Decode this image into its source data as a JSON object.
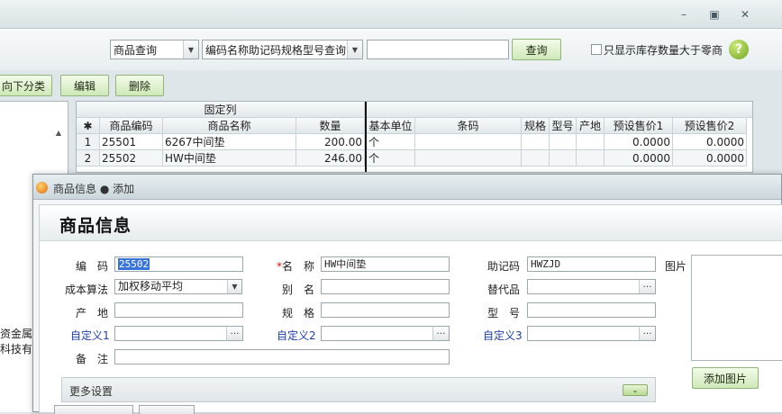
{
  "window": {
    "controls": [
      "minimize",
      "maximize",
      "close"
    ]
  },
  "toolbar": {
    "query_type": "商品查询",
    "query_field": "编码名称助记码规格型号查询",
    "search_value": "",
    "search_button": "查询",
    "stock_filter_label": "只显示库存数量大于零商",
    "help_label": "?",
    "move_down_button": "向下分类",
    "edit_button": "编辑",
    "delete_button": "删除"
  },
  "left_panel": {
    "lines": [
      "资金属",
      "科技有l"
    ]
  },
  "grid": {
    "frozen_label": "固定列",
    "columns": [
      "✱",
      "商品编码",
      "商品名称",
      "数量",
      "基本单位",
      "条码",
      "规格",
      "型号",
      "产地",
      "预设售价1",
      "预设售价2"
    ],
    "rows": [
      [
        "1",
        "25501",
        "6267中间垫",
        "200.00",
        "个",
        "",
        "",
        "",
        "",
        "0.0000",
        "0.0000"
      ],
      [
        "2",
        "25502",
        "HW中间垫",
        "246.00",
        "个",
        "",
        "",
        "",
        "",
        "0.0000",
        "0.0000"
      ]
    ]
  },
  "dialog": {
    "title": "商品信息 ● 添加",
    "heading": "商品信息",
    "labels": {
      "code": "编　码",
      "name": "名　称",
      "mnemonic": "助记码",
      "picture": "图片",
      "cost_method": "成本算法",
      "alias": "别　名",
      "substitute": "替代品",
      "origin": "产　地",
      "spec": "规　格",
      "model": "型　号",
      "custom1": "自定义1",
      "custom2": "自定义2",
      "custom3": "自定义3",
      "remark": "备　注"
    },
    "required_mark": "*",
    "values": {
      "code": "25502",
      "name": "HW中间垫",
      "mnemonic": "HWZJD",
      "cost_method": "加权移动平均",
      "alias": "",
      "substitute": "",
      "origin": "",
      "spec": "",
      "model": "",
      "custom1": "",
      "custom2": "",
      "custom3": "",
      "remark": ""
    },
    "more_settings": "更多设置",
    "add_picture_button": "添加图片"
  }
}
